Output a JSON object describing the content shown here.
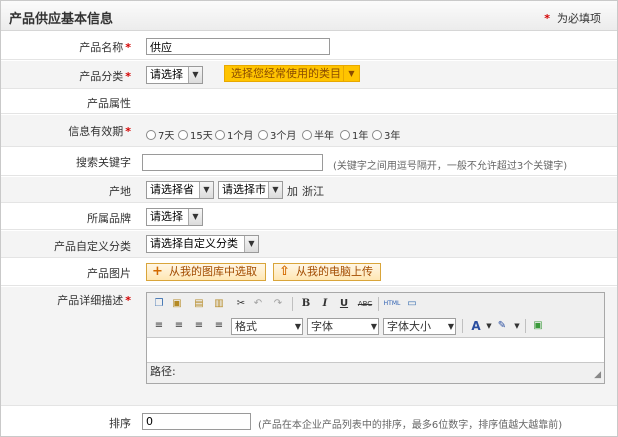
{
  "header": {
    "title": "产品供应基本信息",
    "required_note": "为必填项",
    "star": "*"
  },
  "fields": {
    "name": {
      "label": "产品名称",
      "value": "供应"
    },
    "category": {
      "label": "产品分类",
      "select": "请选择",
      "common_btn": "选择您经常使用的类目"
    },
    "attribute": {
      "label": "产品属性"
    },
    "validity": {
      "label": "信息有效期",
      "options": [
        "7天",
        "15天",
        "1个月",
        "3个月",
        "半年",
        "1年",
        "3年"
      ]
    },
    "keywords": {
      "label": "搜索关键字",
      "value": "",
      "hint": "(关键字之间用逗号隔开，一般不允许超过3个关键字)"
    },
    "origin": {
      "label": "产地",
      "province": "请选择省",
      "city": "请选择市",
      "add": "加",
      "current": "浙江"
    },
    "brand": {
      "label": "所属品牌",
      "select": "请选择"
    },
    "custom_category": {
      "label": "产品自定义分类",
      "select": "请选择自定义分类"
    },
    "images": {
      "label": "产品图片",
      "from_gallery": "从我的图库中选取",
      "from_computer": "从我的电脑上传"
    },
    "description": {
      "label": "产品详细描述"
    },
    "sort": {
      "label": "排序",
      "value": "0",
      "hint": "(产品在本企业产品列表中的排序，最多6位数字，排序值越大越靠前)"
    }
  },
  "editor": {
    "format": "格式",
    "font": "字体",
    "size": "字体大小",
    "path": "路径:",
    "bold": "B",
    "italic": "I",
    "underline": "U",
    "strike": "ABC",
    "html": "HTML",
    "text_color": "A"
  }
}
